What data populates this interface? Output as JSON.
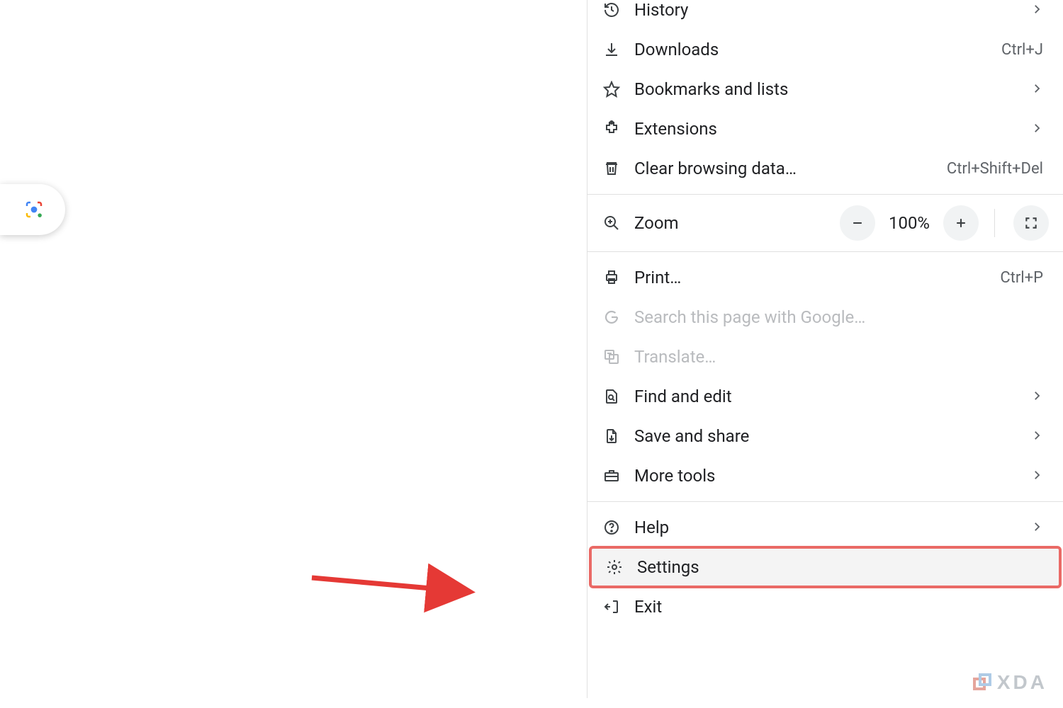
{
  "menu": {
    "history": {
      "label": "History",
      "shortcut": "",
      "submenu": true
    },
    "downloads": {
      "label": "Downloads",
      "shortcut": "Ctrl+J",
      "submenu": false
    },
    "bookmarks": {
      "label": "Bookmarks and lists",
      "shortcut": "",
      "submenu": true
    },
    "extensions": {
      "label": "Extensions",
      "shortcut": "",
      "submenu": true
    },
    "clear_data": {
      "label": "Clear browsing data…",
      "shortcut": "Ctrl+Shift+Del",
      "submenu": false
    },
    "zoom": {
      "label": "Zoom",
      "level": "100%"
    },
    "print": {
      "label": "Print…",
      "shortcut": "Ctrl+P",
      "submenu": false
    },
    "search_page": {
      "label": "Search this page with Google…",
      "disabled": true
    },
    "translate": {
      "label": "Translate…",
      "disabled": true
    },
    "find_edit": {
      "label": "Find and edit",
      "submenu": true
    },
    "save_share": {
      "label": "Save and share",
      "submenu": true
    },
    "more_tools": {
      "label": "More tools",
      "submenu": true
    },
    "help": {
      "label": "Help",
      "submenu": true
    },
    "settings": {
      "label": "Settings"
    },
    "exit": {
      "label": "Exit"
    }
  },
  "annotation": {
    "highlighted_item": "settings"
  },
  "watermark": {
    "text": "XDA"
  }
}
